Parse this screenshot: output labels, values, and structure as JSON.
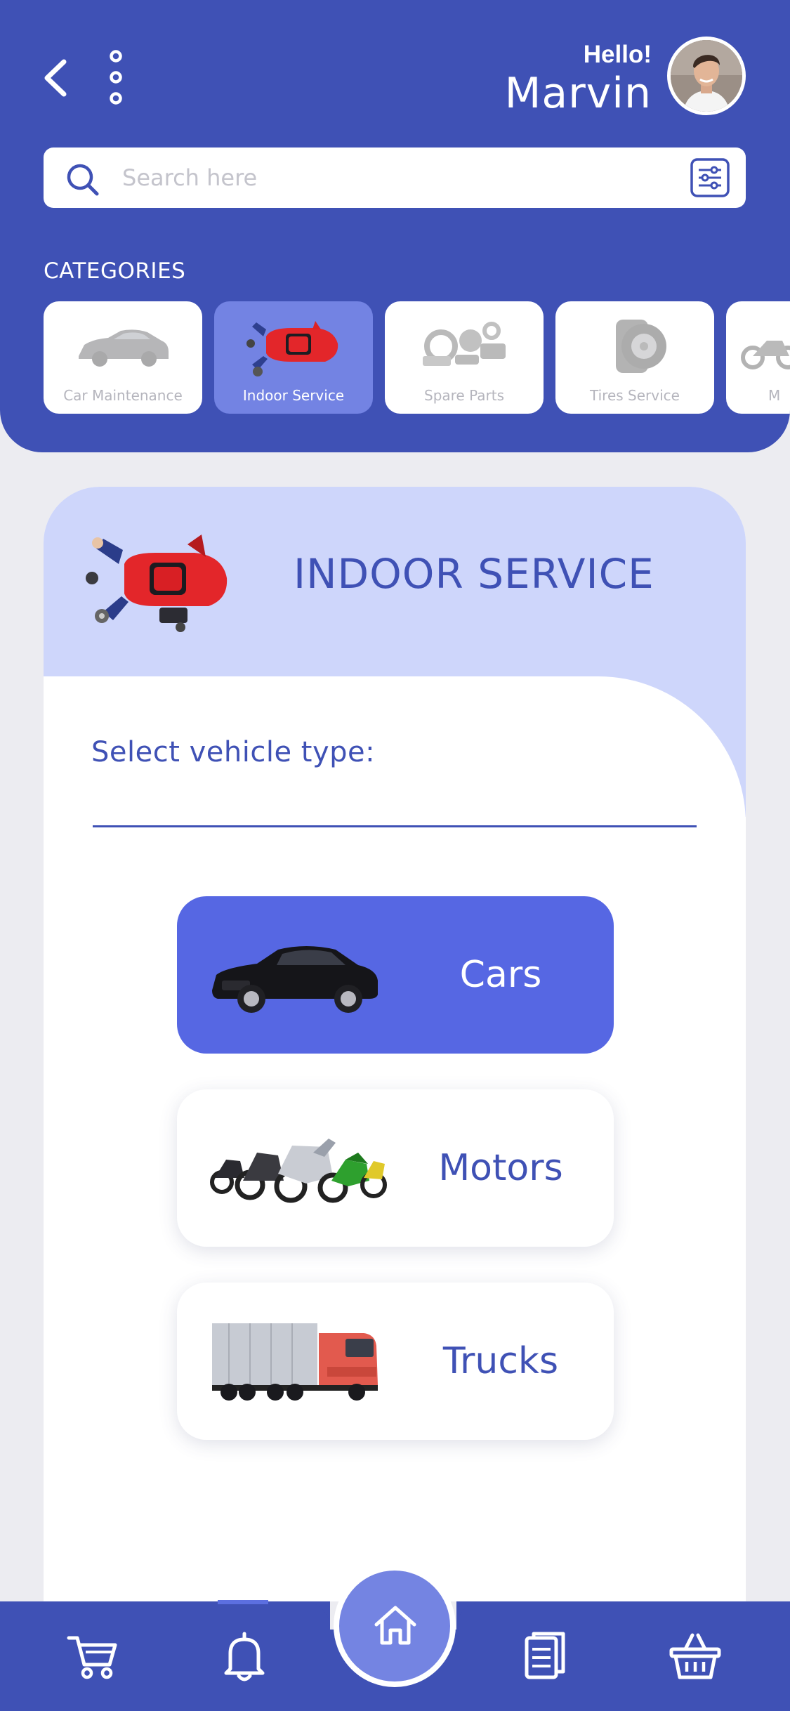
{
  "header": {
    "greeting": "Hello!",
    "user_name": "Marvin",
    "back_icon": "chevron-left-icon",
    "menu_icon": "more-vertical-icon"
  },
  "search": {
    "placeholder": "Search here",
    "icon": "search-icon",
    "filter_icon": "filter-sliders-icon"
  },
  "categories": {
    "title": "CATEGORIES",
    "items": [
      {
        "label": "Car Maintenance",
        "active": false
      },
      {
        "label": "Indoor Service",
        "active": true
      },
      {
        "label": "Spare Parts",
        "active": false
      },
      {
        "label": "Tires Service",
        "active": false
      },
      {
        "label": "M",
        "active": false
      }
    ]
  },
  "service": {
    "title": "INDOOR SERVICE",
    "select_label": "Select vehicle type:",
    "vehicles": [
      {
        "label": "Cars",
        "active": true
      },
      {
        "label": "Motors",
        "active": false
      },
      {
        "label": "Trucks",
        "active": false
      }
    ]
  },
  "nav": {
    "items": [
      "cart-icon",
      "bell-icon",
      "home-icon",
      "document-icon",
      "basket-icon"
    ],
    "active": "home-icon"
  },
  "colors": {
    "primary": "#3f51b5",
    "accent": "#5667e3",
    "light_accent": "#ced6fb",
    "active_chip": "#7383e3"
  }
}
